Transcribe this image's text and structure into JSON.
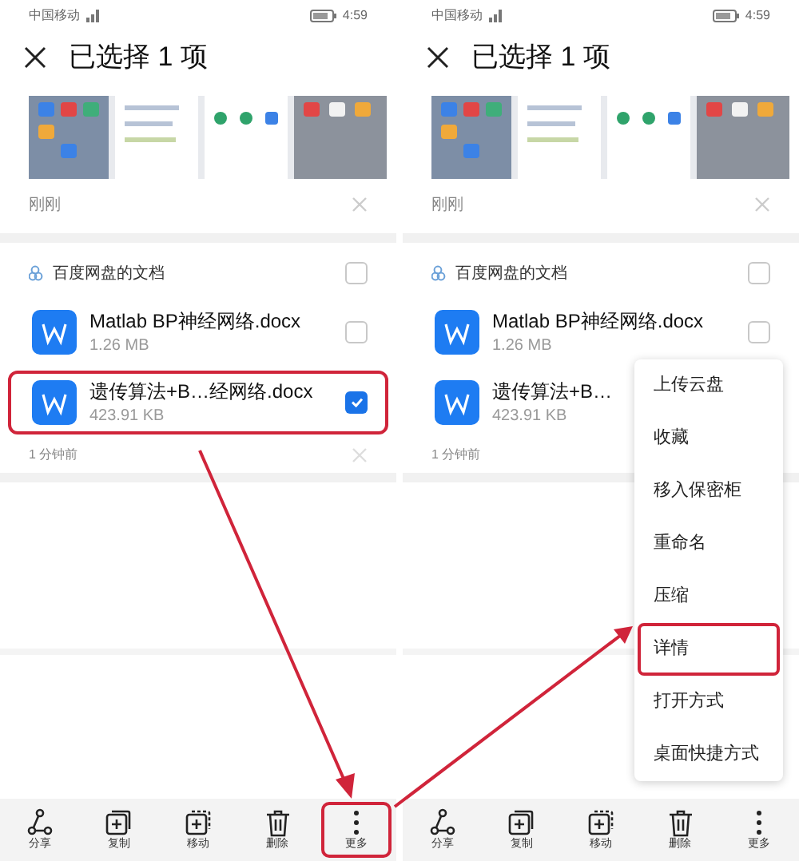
{
  "panels": [
    {
      "status": {
        "carrier": "中国移动",
        "time": "4:59"
      },
      "title": "已选择 1 项",
      "recent": {
        "label": "刚刚"
      },
      "group": {
        "name": "百度网盘的文档",
        "checked": false
      },
      "files": [
        {
          "name": "Matlab BP神经网络.docx",
          "size": "1.26 MB",
          "checked": false,
          "highlighted": false
        },
        {
          "name": "遗传算法+B…经网络.docx",
          "size": "423.91 KB",
          "checked": true,
          "highlighted": true
        }
      ],
      "time_label": "1 分钟前",
      "toolbar": [
        {
          "kind": "share",
          "label": "分享",
          "highlighted": false
        },
        {
          "kind": "copy",
          "label": "复制",
          "highlighted": false
        },
        {
          "kind": "move",
          "label": "移动",
          "highlighted": false
        },
        {
          "kind": "delete",
          "label": "删除",
          "highlighted": false
        },
        {
          "kind": "more",
          "label": "更多",
          "highlighted": true
        }
      ]
    },
    {
      "status": {
        "carrier": "中国移动",
        "time": "4:59"
      },
      "title": "已选择 1 项",
      "recent": {
        "label": "刚刚"
      },
      "group": {
        "name": "百度网盘的文档",
        "checked": false
      },
      "files": [
        {
          "name": "Matlab BP神经网络.docx",
          "size": "1.26 MB",
          "checked": false,
          "highlighted": false
        },
        {
          "name": "遗传算法+B…",
          "size": "423.91 KB",
          "highlighted": false
        }
      ],
      "time_label": "1 分钟前",
      "toolbar": [
        {
          "kind": "share",
          "label": "分享",
          "highlighted": false
        },
        {
          "kind": "copy",
          "label": "复制",
          "highlighted": false
        },
        {
          "kind": "move",
          "label": "移动",
          "highlighted": false
        },
        {
          "kind": "delete",
          "label": "删除",
          "highlighted": false
        },
        {
          "kind": "more",
          "label": "更多",
          "highlighted": false
        }
      ],
      "menu": {
        "items": [
          {
            "label": "上传云盘",
            "highlighted": false
          },
          {
            "label": "收藏",
            "highlighted": false
          },
          {
            "label": "移入保密柜",
            "highlighted": false
          },
          {
            "label": "重命名",
            "highlighted": false
          },
          {
            "label": "压缩",
            "highlighted": false
          },
          {
            "label": "详情",
            "highlighted": true
          },
          {
            "label": "打开方式",
            "highlighted": false
          },
          {
            "label": "桌面快捷方式",
            "highlighted": false
          }
        ]
      }
    }
  ]
}
